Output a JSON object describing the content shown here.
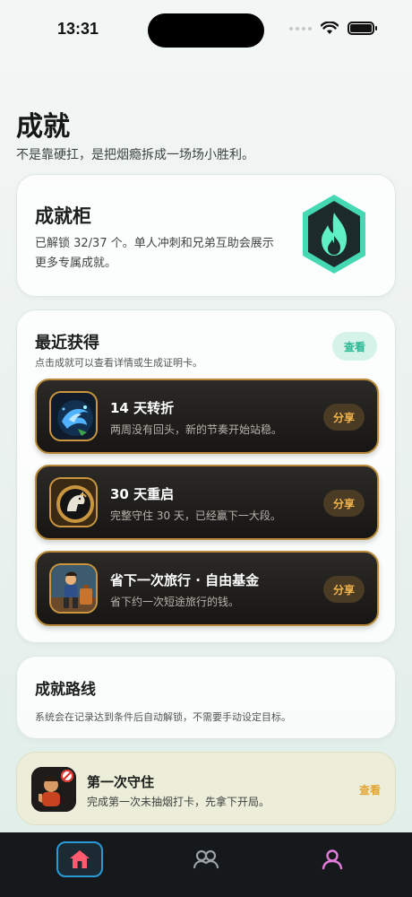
{
  "status": {
    "time": "13:31"
  },
  "header": {
    "title": "成就",
    "subtitle": "不是靠硬扛，是把烟瘾拆成一场场小胜利。"
  },
  "cabinet": {
    "title": "成就柜",
    "description": "已解锁 32/37 个。单人冲刺和兄弟互助会展示更多专属成就。",
    "badge_icon": "flame-shield-icon"
  },
  "recent": {
    "title": "最近获得",
    "subtitle": "点击成就可以查看详情或生成证明卡。",
    "view_label": "查看",
    "items": [
      {
        "title": "14 天转折",
        "desc": "两周没有回头，新的节奏开始站稳。",
        "share_label": "分享",
        "icon": "blue-wave-badge-icon"
      },
      {
        "title": "30 天重启",
        "desc": "完整守住 30 天，已经赢下一大段。",
        "share_label": "分享",
        "icon": "horse-medal-icon"
      },
      {
        "title": "省下一次旅行 · 自由基金",
        "desc": "省下约一次短途旅行的钱。",
        "share_label": "分享",
        "icon": "traveler-icon"
      }
    ]
  },
  "route": {
    "title": "成就路线",
    "description": "系统会在记录达到条件后自动解锁，不需要手动设定目标。"
  },
  "first_guard": {
    "title": "第一次守住",
    "desc": "完成第一次未抽烟打卡，先拿下开局。",
    "view_label": "查看",
    "icon": "no-smoking-character-icon"
  },
  "tabs": [
    {
      "name": "home",
      "icon": "home-icon",
      "active": true
    },
    {
      "name": "friends",
      "icon": "group-icon",
      "active": false
    },
    {
      "name": "profile",
      "icon": "profile-icon",
      "active": false
    }
  ],
  "colors": {
    "accent_green": "#2bb894",
    "accent_gold": "#f4b54c",
    "tab_active": "#2a9ad6",
    "dark_card": "#1f1e1b"
  }
}
